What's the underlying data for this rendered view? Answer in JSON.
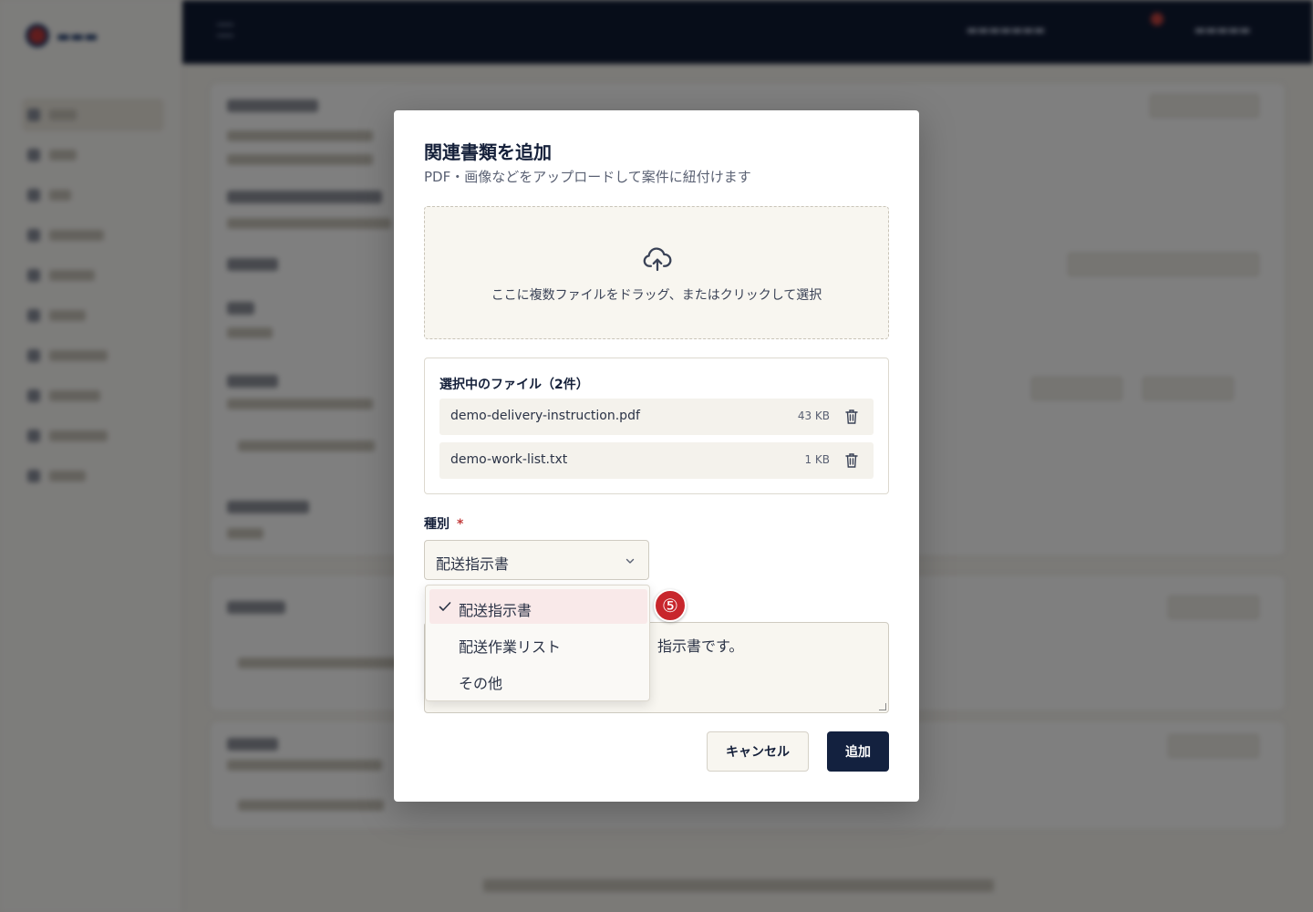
{
  "modal": {
    "title": "関連書類を追加",
    "subtitle": "PDF・画像などをアップロードして案件に紐付けます"
  },
  "dropzone": {
    "icon": "cloud-upload-icon",
    "text": "ここに複数ファイルをドラッグ、またはクリックして選択"
  },
  "files": {
    "title": "選択中のファイル（2件）",
    "items": [
      {
        "name": "demo-delivery-instruction.pdf",
        "size": "43 KB",
        "icon": "trash-icon"
      },
      {
        "name": "demo-work-list.txt",
        "size": "1 KB",
        "icon": "trash-icon"
      }
    ]
  },
  "type_field": {
    "label": "種別",
    "required_mark": "*",
    "value": "配送指示書",
    "options": [
      "配送指示書",
      "配送作業リスト",
      "その他"
    ],
    "selected_index": 0
  },
  "memo": {
    "visible_text": "指示書です。"
  },
  "buttons": {
    "cancel": "キャンセル",
    "add": "追加"
  },
  "annotation": {
    "step": "⑤"
  },
  "colors": {
    "primary": "#13213f",
    "required": "#c23b3b",
    "selected_option_bg": "#f9e9e9",
    "step_badge": "#c8262c",
    "topbar": "#0f1a33"
  }
}
